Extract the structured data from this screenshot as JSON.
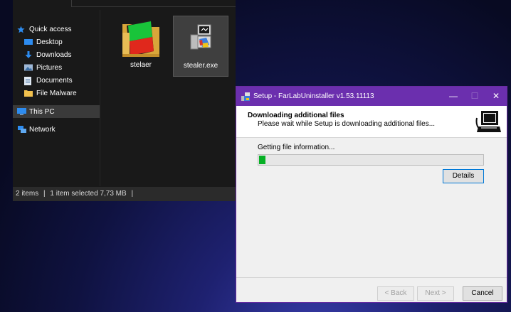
{
  "explorer": {
    "nav": {
      "quick_access": "Quick access",
      "desktop": "Desktop",
      "downloads": "Downloads",
      "pictures": "Pictures",
      "documents": "Documents",
      "file_malware": "File Malware",
      "this_pc": "This PC",
      "network": "Network"
    },
    "files": [
      {
        "name": "stelaer"
      },
      {
        "name": "stealer.exe"
      }
    ],
    "status": {
      "items": "2 items",
      "selected": "1 item selected  7,73 MB"
    }
  },
  "setup": {
    "title": "Setup - FarLabUninstaller v1.53.11113",
    "header_title": "Downloading additional files",
    "header_subtitle": "Please wait while Setup is downloading additional files...",
    "status_text": "Getting file information...",
    "progress": 0.03,
    "details_label": "Details",
    "back_label": "< Back",
    "next_label": "Next >",
    "cancel_label": "Cancel",
    "title_color": "#6b2fae"
  },
  "icons": {
    "pin": "pin-icon",
    "star": "star-icon",
    "folder": "folder-icon",
    "installer": "installer-icon",
    "computer": "computer-icon"
  }
}
